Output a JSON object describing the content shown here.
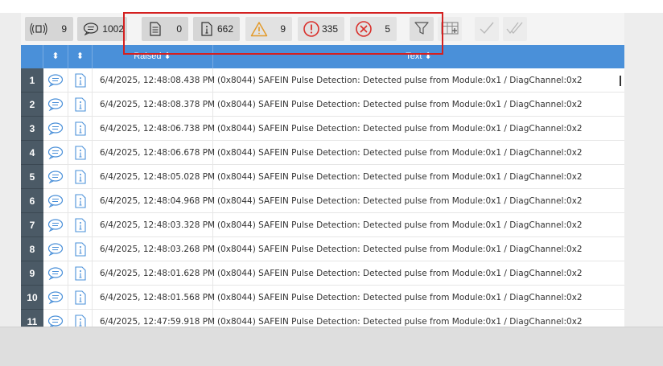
{
  "toolbar": {
    "counters": [
      {
        "name": "connection",
        "value": "9"
      },
      {
        "name": "messages",
        "value": "1002"
      },
      {
        "name": "document",
        "value": "0"
      },
      {
        "name": "info",
        "value": "662"
      },
      {
        "name": "warning",
        "value": "9"
      },
      {
        "name": "alert",
        "value": "335"
      },
      {
        "name": "error",
        "value": "5"
      }
    ],
    "icons": [
      "filter-icon",
      "add-column-icon",
      "check-icon",
      "double-check-icon"
    ]
  },
  "colors": {
    "header": "#4a90d9",
    "row_number": "#4b5a66",
    "highlight": "#d42020"
  },
  "table": {
    "headers": {
      "col1_sort": "⬍",
      "col2_sort": "⬍",
      "raised": "Raised ⬍",
      "text": "Text ⬍"
    },
    "rows": [
      {
        "n": "1",
        "raised": "6/4/2025, 12:48:08.438 PM",
        "text": "(0x8044) SAFEIN Pulse Detection: Detected pulse from Module:0x1 / DiagChannel:0x2"
      },
      {
        "n": "2",
        "raised": "6/4/2025, 12:48:08.378 PM",
        "text": "(0x8044) SAFEIN Pulse Detection: Detected pulse from Module:0x1 / DiagChannel:0x2"
      },
      {
        "n": "3",
        "raised": "6/4/2025, 12:48:06.738 PM",
        "text": "(0x8044) SAFEIN Pulse Detection: Detected pulse from Module:0x1 / DiagChannel:0x2"
      },
      {
        "n": "4",
        "raised": "6/4/2025, 12:48:06.678 PM",
        "text": "(0x8044) SAFEIN Pulse Detection: Detected pulse from Module:0x1 / DiagChannel:0x2"
      },
      {
        "n": "5",
        "raised": "6/4/2025, 12:48:05.028 PM",
        "text": "(0x8044) SAFEIN Pulse Detection: Detected pulse from Module:0x1 / DiagChannel:0x2"
      },
      {
        "n": "6",
        "raised": "6/4/2025, 12:48:04.968 PM",
        "text": "(0x8044) SAFEIN Pulse Detection: Detected pulse from Module:0x1 / DiagChannel:0x2"
      },
      {
        "n": "7",
        "raised": "6/4/2025, 12:48:03.328 PM",
        "text": "(0x8044) SAFEIN Pulse Detection: Detected pulse from Module:0x1 / DiagChannel:0x2"
      },
      {
        "n": "8",
        "raised": "6/4/2025, 12:48:03.268 PM",
        "text": "(0x8044) SAFEIN Pulse Detection: Detected pulse from Module:0x1 / DiagChannel:0x2"
      },
      {
        "n": "9",
        "raised": "6/4/2025, 12:48:01.628 PM",
        "text": "(0x8044) SAFEIN Pulse Detection: Detected pulse from Module:0x1 / DiagChannel:0x2"
      },
      {
        "n": "10",
        "raised": "6/4/2025, 12:48:01.568 PM",
        "text": "(0x8044) SAFEIN Pulse Detection: Detected pulse from Module:0x1 / DiagChannel:0x2"
      },
      {
        "n": "11",
        "raised": "6/4/2025, 12:47:59.918 PM",
        "text": "(0x8044) SAFEIN Pulse Detection: Detected pulse from Module:0x1 / DiagChannel:0x2"
      }
    ]
  }
}
